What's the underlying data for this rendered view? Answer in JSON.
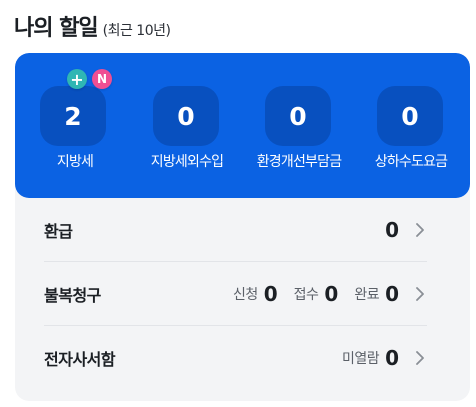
{
  "header": {
    "title": "나의 할일",
    "subtitle": "(최근 10년)"
  },
  "colors": {
    "panel_blue": "#0b62e3",
    "box_blue": "#0850bf",
    "badge_plus": "#2fb6b4",
    "badge_new": "#ef4f93",
    "card_bg": "#f3f4f6"
  },
  "stats": [
    {
      "value": "2",
      "label": "지방세"
    },
    {
      "value": "0",
      "label": "지방세외수입"
    },
    {
      "value": "0",
      "label": "환경개선부담금"
    },
    {
      "value": "0",
      "label": "상하수도요금"
    }
  ],
  "badges": {
    "plus": "+",
    "new": "N"
  },
  "rows": {
    "refund": {
      "label": "환급",
      "value": "0"
    },
    "appeal": {
      "label": "불복청구",
      "apply_label": "신청",
      "apply_value": "0",
      "receipt_label": "접수",
      "receipt_value": "0",
      "complete_label": "완료",
      "complete_value": "0"
    },
    "edoc": {
      "label": "전자사서함",
      "unread_label": "미열람",
      "unread_value": "0"
    }
  },
  "icons": {
    "row_chevron": "chevron-right-icon"
  }
}
